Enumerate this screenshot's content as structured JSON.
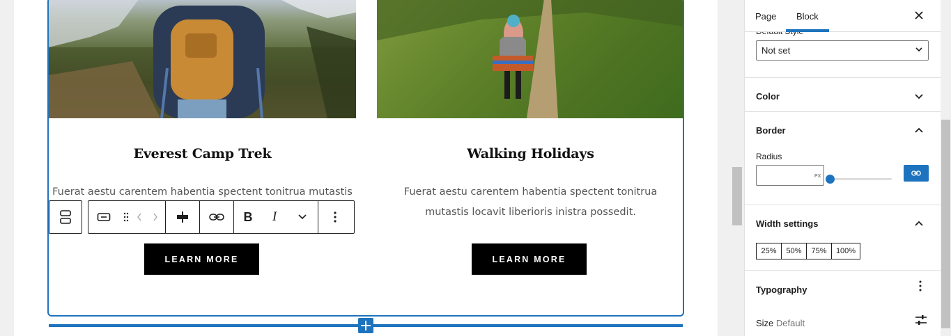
{
  "cards": [
    {
      "title": "Everest Camp Trek",
      "text": "Fuerat aestu carentem habentia spectent tonitrua mutastis",
      "button": "LEARN MORE"
    },
    {
      "title": "Walking Holidays",
      "text": "Fuerat aestu carentem habentia spectent tonitrua mutastis locavit liberioris inistra possedit.",
      "button": "LEARN MORE"
    }
  ],
  "toolbar": {
    "bold": "B",
    "italic": "I"
  },
  "sidebar": {
    "tabs": [
      "Page",
      "Block"
    ],
    "active_tab": "Block",
    "default_style_label": "Default Style",
    "default_style_value": "Not set",
    "sections": {
      "color": "Color",
      "border": "Border",
      "radius_label": "Radius",
      "radius_unit": "PX",
      "width_settings": "Width settings",
      "width_options": [
        "25%",
        "50%",
        "75%",
        "100%"
      ],
      "typography": "Typography",
      "size_label": "Size",
      "size_value": "Default"
    }
  },
  "colors": {
    "accent": "#1e73be",
    "button_bg": "#000000"
  }
}
